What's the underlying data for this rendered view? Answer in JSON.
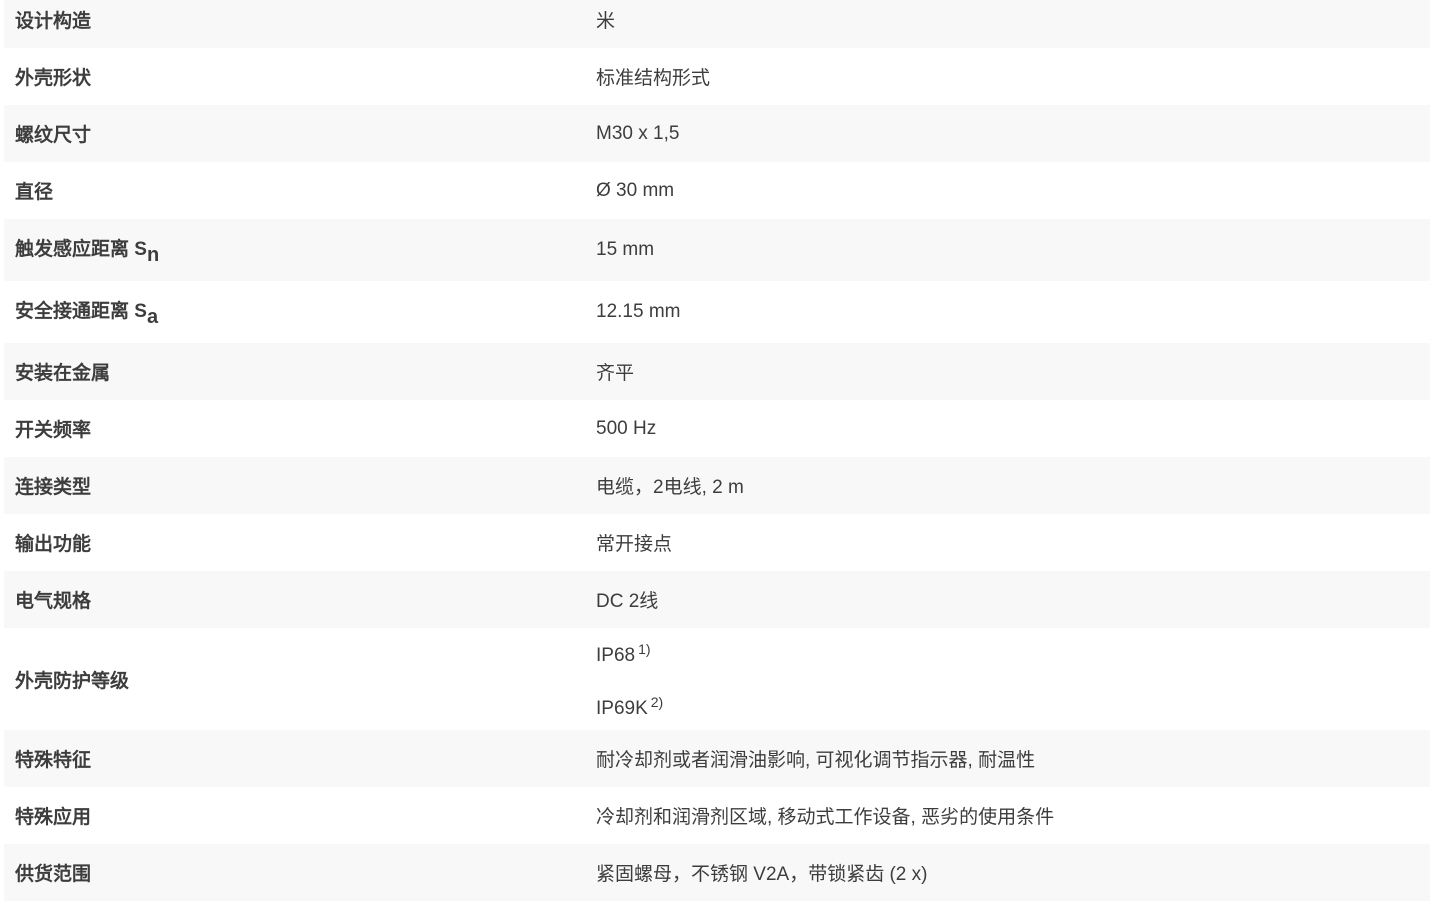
{
  "rows": [
    {
      "label": "设计构造",
      "value": "米"
    },
    {
      "label": "外壳形状",
      "value": "标准结构形式"
    },
    {
      "label": "螺纹尺寸",
      "value": "M30 x 1,5"
    },
    {
      "label": "直径",
      "value": "Ø 30 mm"
    },
    {
      "label": "触发感应距离 S",
      "label_sub": "n",
      "value": "15 mm"
    },
    {
      "label": "安全接通距离 S",
      "label_sub": "a",
      "value": "12.15 mm"
    },
    {
      "label": "安装在金属",
      "value": "齐平"
    },
    {
      "label": "开关频率",
      "value": "500 Hz"
    },
    {
      "label": "连接类型",
      "value": "电缆，2电线, 2 m"
    },
    {
      "label": "输出功能",
      "value": "常开接点"
    },
    {
      "label": "电气规格",
      "value": "DC 2线"
    },
    {
      "label": "外壳防护等级",
      "values": [
        {
          "text": "IP68",
          "footnote": "1)"
        },
        {
          "text": "IP69K",
          "footnote": "2)"
        }
      ]
    },
    {
      "label": "特殊特征",
      "value": "耐冷却剂或者润滑油影响, 可视化调节指示器, 耐温性"
    },
    {
      "label": "特殊应用",
      "value": "冷却剂和润滑剂区域, 移动式工作设备, 恶劣的使用条件"
    },
    {
      "label": "供货范围",
      "value": "紧固螺母，不锈钢 V2A，带锁紧齿 (2 x)"
    }
  ]
}
